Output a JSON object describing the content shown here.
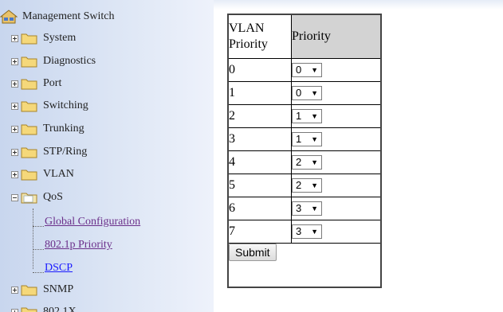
{
  "tree": {
    "root_label": "Management Switch",
    "nodes": [
      {
        "label": "System",
        "expander": "plus"
      },
      {
        "label": "Diagnostics",
        "expander": "plus"
      },
      {
        "label": "Port",
        "expander": "plus"
      },
      {
        "label": "Switching",
        "expander": "plus"
      },
      {
        "label": "Trunking",
        "expander": "plus"
      },
      {
        "label": "STP/Ring",
        "expander": "plus"
      },
      {
        "label": "VLAN",
        "expander": "plus"
      },
      {
        "label": "QoS",
        "expander": "minus"
      },
      {
        "label": "SNMP",
        "expander": "plus"
      },
      {
        "label": "802.1X",
        "expander": "plus"
      }
    ],
    "qos_children": [
      "Global Configuration",
      "802.1p Priority",
      "DSCP"
    ]
  },
  "table": {
    "header_col1": "VLAN Priority",
    "header_col2": "Priority",
    "rows": [
      {
        "vlan_priority": "0",
        "priority": "0"
      },
      {
        "vlan_priority": "1",
        "priority": "0"
      },
      {
        "vlan_priority": "2",
        "priority": "1"
      },
      {
        "vlan_priority": "3",
        "priority": "1"
      },
      {
        "vlan_priority": "4",
        "priority": "2"
      },
      {
        "vlan_priority": "5",
        "priority": "2"
      },
      {
        "vlan_priority": "6",
        "priority": "3"
      },
      {
        "vlan_priority": "7",
        "priority": "3"
      }
    ],
    "submit_label": "Submit"
  },
  "icons": {
    "root": "network-switch-icon",
    "folder": "folder-icon",
    "open_folder": "open-folder-icon",
    "dropdown": "dropdown-arrow-icon"
  },
  "colors": {
    "sidebar_bg": "#dde6f5",
    "header_bg": "#d3d3d3",
    "link": "#3a3aa0",
    "link_visited": "#6b2f8a",
    "link_active": "#1a1aff"
  }
}
